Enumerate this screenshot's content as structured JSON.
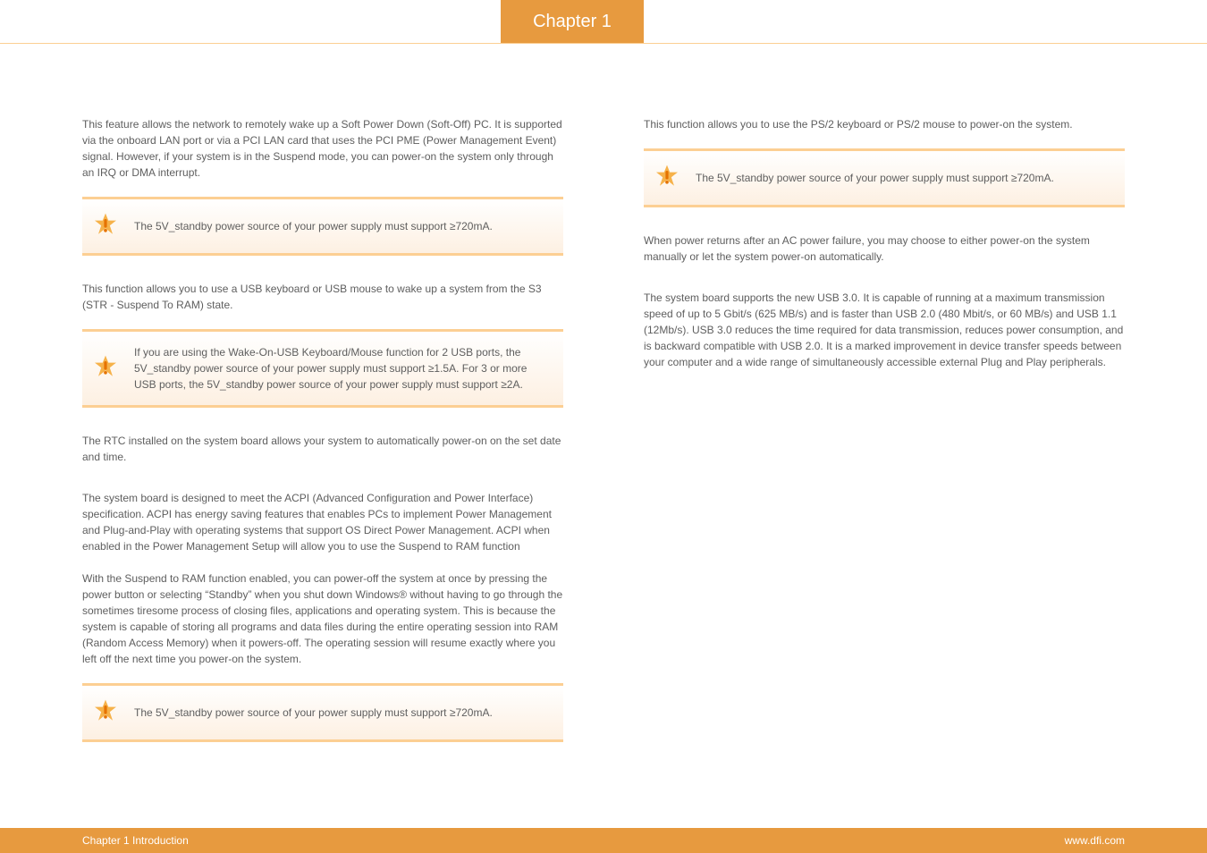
{
  "chapter_tab": "Chapter 1",
  "left": {
    "p1": "This feature allows the network to remotely wake up a Soft Power Down (Soft-Off) PC. It is supported via the onboard LAN port or via a PCI LAN card that uses the PCI PME (Power Management Event) signal. However, if your system is in the Suspend mode, you can power-on the system only through an IRQ or DMA interrupt.",
    "imp1": "The 5V_standby power source of your power supply must support ≥720mA.",
    "p2": "This function allows you to use a USB keyboard or USB mouse to wake up a system from the S3 (STR - Suspend To RAM) state.",
    "imp2": "If you are using the Wake-On-USB Keyboard/Mouse function for 2 USB ports, the 5V_standby power source of your power supply must support ≥1.5A. For 3 or more USB ports, the 5V_standby power source of your power supply must support ≥2A.",
    "p3": "The RTC installed on the system board allows your system to automatically power-on on the set date and time.",
    "p4": "The system board is designed to meet the ACPI (Advanced Configuration and Power Interface) specification. ACPI has energy saving features that enables PCs to implement Power Management and Plug-and-Play with operating systems that support OS Direct Power Management. ACPI when enabled in the Power Management Setup will allow you to use the Suspend to RAM function",
    "p5": "With the Suspend to RAM function enabled, you can power-off the system at once by pressing the power button or selecting “Standby” when you shut down Windows® without having to go through the sometimes tiresome process of closing files, applications and operating system. This is because the system is capable of storing all programs and data files during the entire operating session into RAM (Random Access Memory) when it powers-off. The operating session will resume exactly where you left off the next time you power-on the system.",
    "imp3": "The 5V_standby power source of your power supply must support ≥720mA."
  },
  "right": {
    "p1": "This function allows you to use the PS/2 keyboard or PS/2 mouse to power-on the system.",
    "imp1": "The 5V_standby power source of your power supply must support ≥720mA.",
    "p2": "When power returns after an AC power failure, you may choose to either power-on the system manually or let the system power-on automatically.",
    "p3": "The system board supports the new USB 3.0. It is capable of running at a maximum transmission speed of up to 5 Gbit/s (625 MB/s) and is faster than USB 2.0 (480 Mbit/s, or 60 MB/s) and USB 1.1 (12Mb/s). USB 3.0 reduces the time required for data transmission, reduces power consumption, and is backward compatible with USB 2.0. It is  a marked  improvement in  device  transfer  speeds  between  your  computer  and  a wide range of simultaneously accessible external Plug and Play peripherals."
  },
  "footer": {
    "left": "Chapter 1 Introduction",
    "right": "www.dfi.com"
  }
}
